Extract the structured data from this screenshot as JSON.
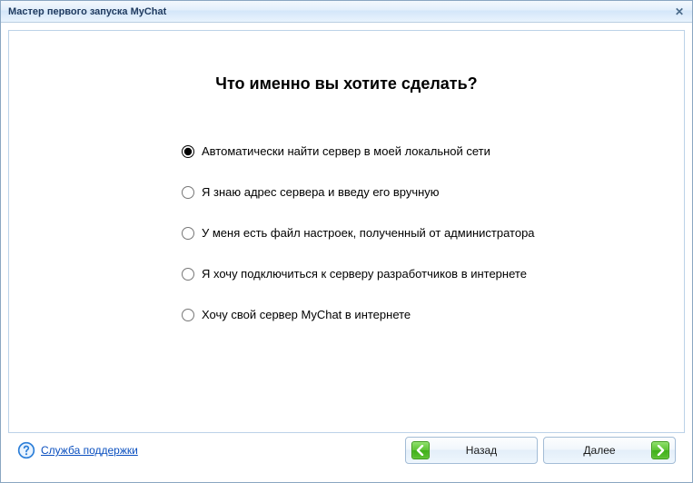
{
  "window": {
    "title": "Мастер первого запуска MyChat"
  },
  "main": {
    "heading": "Что именно вы хотите сделать?",
    "options": [
      {
        "label": "Автоматически найти сервер в моей локальной сети",
        "selected": true
      },
      {
        "label": "Я знаю адрес сервера и введу его вручную",
        "selected": false
      },
      {
        "label": "У меня есть файл настроек, полученный от администратора",
        "selected": false
      },
      {
        "label": "Я хочу подключиться к серверу разработчиков в интернете",
        "selected": false
      },
      {
        "label": "Хочу свой сервер MyChat в интернете",
        "selected": false
      }
    ]
  },
  "footer": {
    "help_link": "Служба поддержки",
    "back_label": "Назад",
    "next_label": "Далее"
  },
  "colors": {
    "accent_blue": "#0a4fbf",
    "border_blue": "#8aa6c1",
    "arrow_green": "#5cc233"
  }
}
